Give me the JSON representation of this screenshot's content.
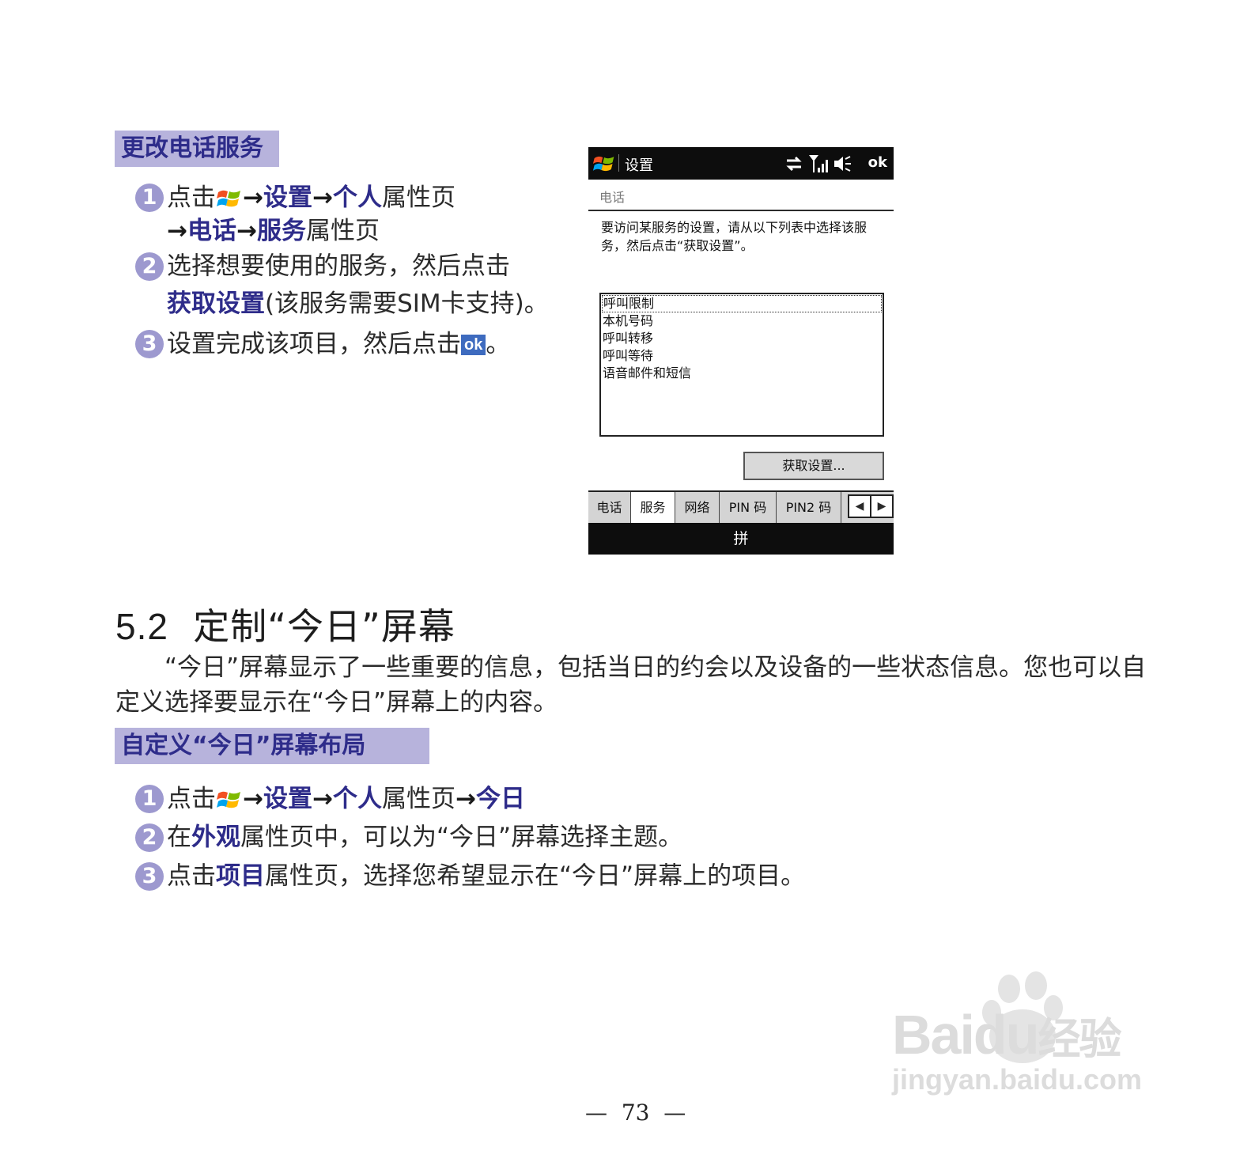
{
  "section1": {
    "label": "更改电话服务",
    "steps": [
      {
        "num": "1",
        "t1": "点击",
        "k1": "设置",
        "k2": "个人",
        "t2": "属性页",
        "k3": "电话",
        "k4": "服务",
        "t3": "属性页"
      },
      {
        "num": "2",
        "t1": "选择想要使用的服务，然后点击",
        "k1": "获取设置",
        "t2": "(该服务需要SIM卡支持)。"
      },
      {
        "num": "3",
        "t1": "设置完成该项目，然后点击",
        "ok": "ok",
        "t2": "。"
      }
    ]
  },
  "phone": {
    "title": "设置",
    "ok": "ok",
    "page_title": "电话",
    "instruction": "要访问某服务的设置，请从以下列表中选择该服务，然后点击“获取设置”。",
    "services": [
      "呼叫限制",
      "本机号码",
      "呼叫转移",
      "呼叫等待",
      "语音邮件和短信"
    ],
    "button": "获取设置...",
    "tabs": [
      "电话",
      "服务",
      "网络",
      "PIN 码",
      "PIN2 码"
    ],
    "active_tab": "服务",
    "input_method": "拼"
  },
  "heading": {
    "num": "5.2",
    "text": "定制“今日”屏幕"
  },
  "paragraph": "“今日”屏幕显示了一些重要的信息，包括当日的约会以及设备的一些状态信息。您也可以自定义选择要显示在“今日”屏幕上的内容。",
  "section2": {
    "label": "自定义“今日”屏幕布局",
    "steps": [
      {
        "num": "1",
        "t1": "点击",
        "k1": "设置",
        "k2": "个人",
        "t2": "属性页",
        "k3": "今日"
      },
      {
        "num": "2",
        "t1": "在",
        "k1": "外观",
        "t2": "属性页中，可以为“今日”屏幕选择主题。"
      },
      {
        "num": "3",
        "t1": "点击",
        "k1": "项目",
        "t2": "属性页，选择您希望显示在“今日”屏幕上的项目。"
      }
    ]
  },
  "page_number": "73",
  "watermark": {
    "brand": "Baidu",
    "brand_cn": "经验",
    "url": "jingyan.baidu.com"
  }
}
